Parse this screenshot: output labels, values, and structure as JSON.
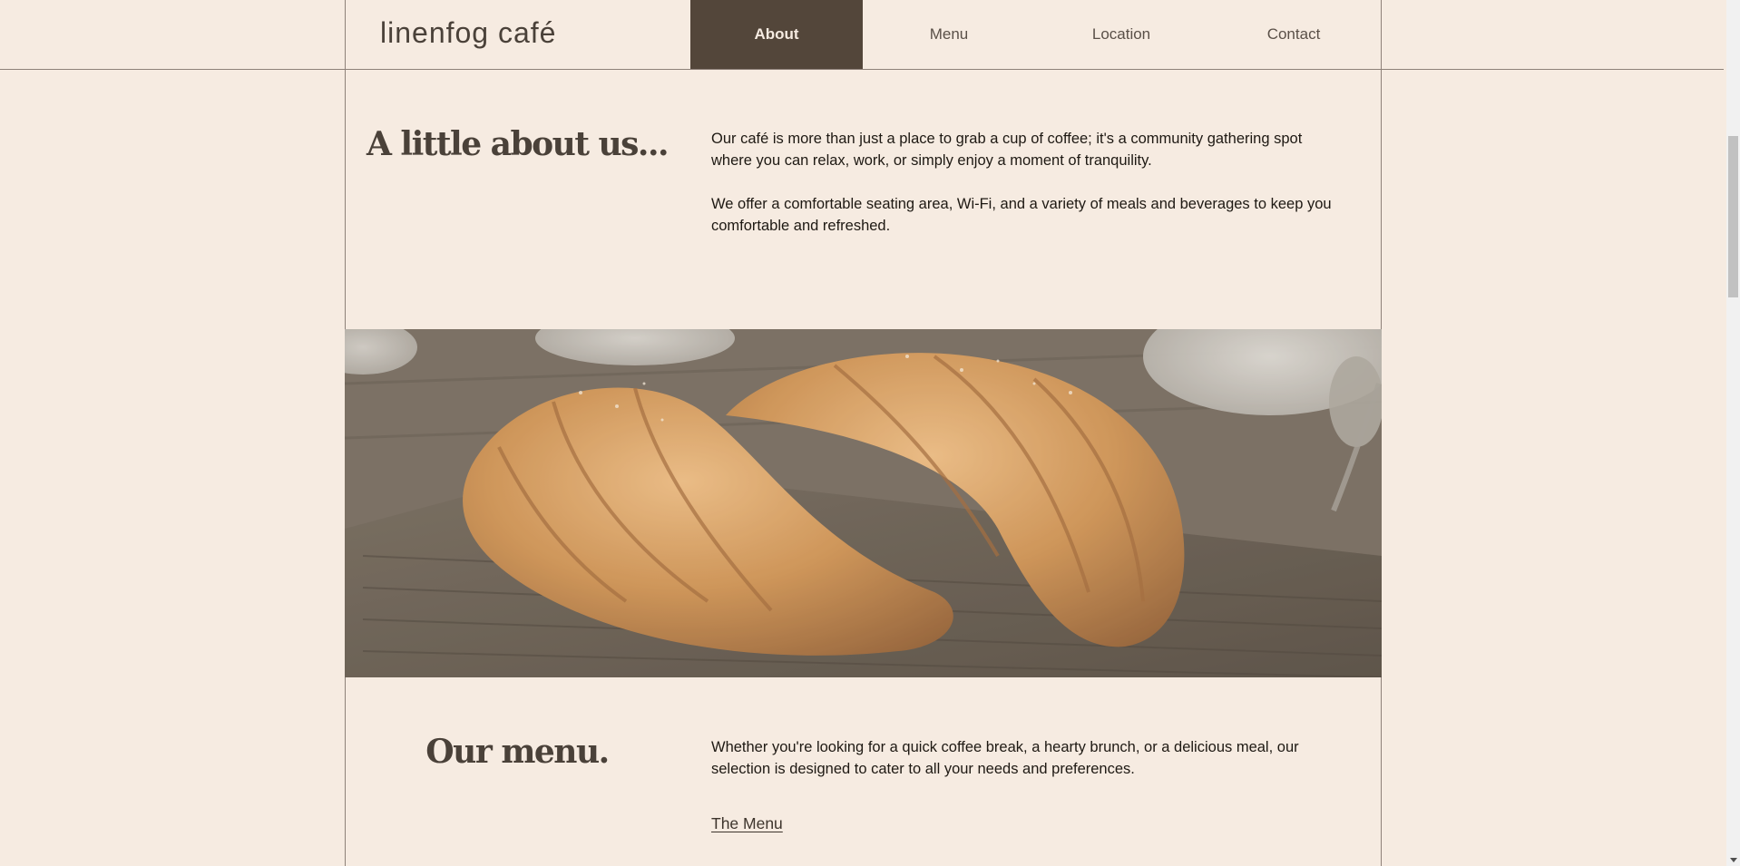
{
  "brand": "linenfog café",
  "nav": {
    "items": [
      {
        "label": "About",
        "active": true
      },
      {
        "label": "Menu",
        "active": false
      },
      {
        "label": "Location",
        "active": false
      },
      {
        "label": "Contact",
        "active": false
      }
    ]
  },
  "about": {
    "title": "A little about us...",
    "paragraph_1": "Our café is more than just a place to grab a cup of coffee; it's a community gathering spot where you can relax, work, or simply enjoy a moment of tranquility.",
    "paragraph_2": "We offer a comfortable seating area, Wi-Fi, and a variety of meals and beverages to keep you comfortable and refreshed."
  },
  "hero_image": {
    "subject": "croissants"
  },
  "menu_section": {
    "title": "Our menu.",
    "paragraph": "Whether you're looking for a quick coffee break, a hearty brunch, or a delicious meal, our selection is designed to cater to all your needs and preferences.",
    "link_label": "The Menu"
  },
  "colors": {
    "background": "#f6ebe1",
    "nav_active": "#53463a",
    "heading": "#4a4139",
    "border": "#8e8179"
  }
}
